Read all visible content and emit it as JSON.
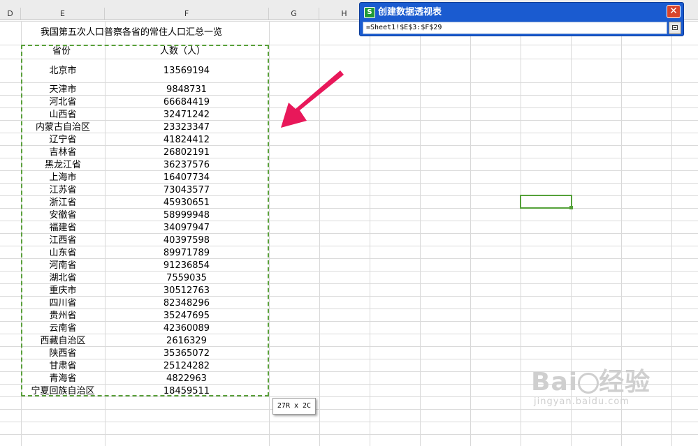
{
  "columns": [
    "D",
    "E",
    "F",
    "G",
    "H"
  ],
  "sheet": {
    "title": "我国第五次人口普察各省的常住人口汇总一览",
    "header": {
      "province": "省份",
      "population": "人数（人）"
    },
    "rows": [
      {
        "province": "北京市",
        "population": "13569194"
      },
      {
        "province": "天津市",
        "population": "9848731"
      },
      {
        "province": "河北省",
        "population": "66684419"
      },
      {
        "province": "山西省",
        "population": "32471242"
      },
      {
        "province": "内蒙古自治区",
        "population": "23323347"
      },
      {
        "province": "辽宁省",
        "population": "41824412"
      },
      {
        "province": "吉林省",
        "population": "26802191"
      },
      {
        "province": "黑龙江省",
        "population": "36237576"
      },
      {
        "province": "上海市",
        "population": "16407734"
      },
      {
        "province": "江苏省",
        "population": "73043577"
      },
      {
        "province": "浙江省",
        "population": "45930651"
      },
      {
        "province": "安徽省",
        "population": "58999948"
      },
      {
        "province": "福建省",
        "population": "34097947"
      },
      {
        "province": "江西省",
        "population": "40397598"
      },
      {
        "province": "山东省",
        "population": "89971789"
      },
      {
        "province": "河南省",
        "population": "91236854"
      },
      {
        "province": "湖北省",
        "population": "7559035"
      },
      {
        "province": "重庆市",
        "population": "30512763"
      },
      {
        "province": "四川省",
        "population": "82348296"
      },
      {
        "province": "贵州省",
        "population": "35247695"
      },
      {
        "province": "云南省",
        "population": "42360089"
      },
      {
        "province": "西藏自治区",
        "population": "2616329"
      },
      {
        "province": "陕西省",
        "population": "35365072"
      },
      {
        "province": "甘肃省",
        "population": "25124282"
      },
      {
        "province": "青海省",
        "population": "4822963"
      },
      {
        "province": "宁夏回族自治区",
        "population": "18459511"
      }
    ]
  },
  "dialog": {
    "icon_letter": "S",
    "title": "创建数据透视表",
    "range": "=Sheet1!$E$3:$F$29",
    "close_glyph": "✕"
  },
  "size_tooltip": "27R x 2C",
  "watermark": {
    "main": "Bai",
    "main2": "经验",
    "sub": "jingyan.baidu.com"
  },
  "colors": {
    "selection": "#59a03a",
    "arrow": "#e8185a",
    "dialog": "#1a5bd0"
  }
}
